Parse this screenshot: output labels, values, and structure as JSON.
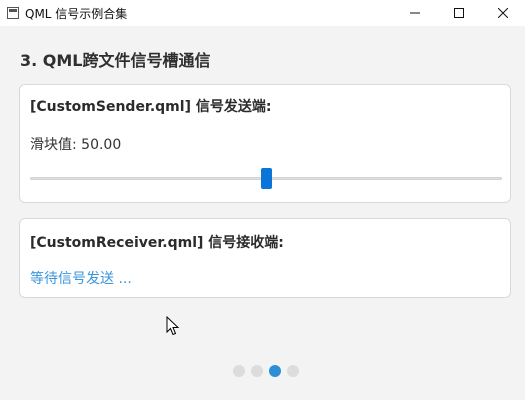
{
  "window": {
    "title": "QML 信号示例合集",
    "controls": {
      "minimize": "─",
      "maximize": "☐",
      "close": "✕"
    }
  },
  "page": {
    "title": "3. QML跨文件信号槽通信"
  },
  "sender": {
    "heading": "[CustomSender.qml] 信号发送端:",
    "value_text": "滑块值: 50.00",
    "slider": {
      "value": 50.0,
      "min": 0,
      "max": 100
    }
  },
  "receiver": {
    "heading": "[CustomReceiver.qml] 信号接收端:",
    "status": "等待信号发送 ..."
  },
  "pagination": {
    "count": 4,
    "active_index": 2
  },
  "colors": {
    "accent": "#0a74d9",
    "status_text": "#3a96dd",
    "dot_active": "#2c8fd6",
    "dot_inactive": "#dcdcdc"
  }
}
